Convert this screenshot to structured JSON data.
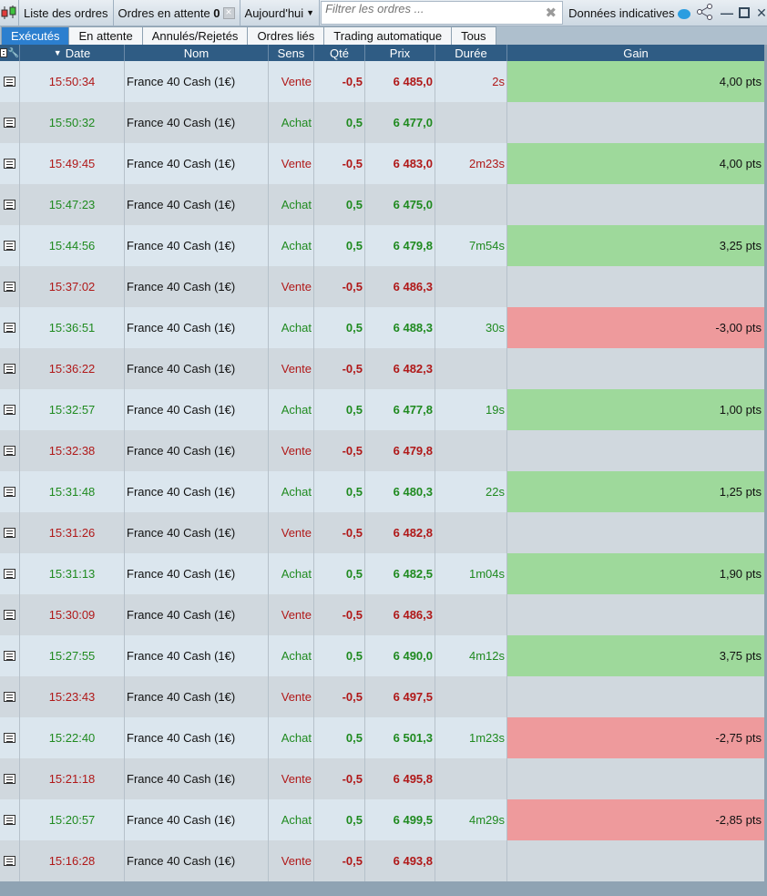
{
  "toolbar": {
    "logo_icon": "candlestick-chart-icon",
    "list_label": "Liste des ordres",
    "pending_label": "Ordres en attente",
    "pending_count": "0",
    "period_label": "Aujourd'hui",
    "filter_placeholder": "Filtrer les ordres ...",
    "data_label": "Données indicatives"
  },
  "tabs": [
    {
      "label": "Exécutés",
      "active": true
    },
    {
      "label": "En attente"
    },
    {
      "label": "Annulés/Rejetés"
    },
    {
      "label": "Ordres liés"
    },
    {
      "label": "Trading automatique"
    },
    {
      "label": "Tous"
    }
  ],
  "columns": {
    "date": "Date",
    "nom": "Nom",
    "sens": "Sens",
    "qte": "Qté",
    "prix": "Prix",
    "duree": "Durée",
    "gain": "Gain"
  },
  "colors": {
    "buy": "#1f8a1f",
    "sell": "#b01818",
    "gain_positive": "#9ed99b",
    "gain_negative": "#ee9a9c"
  },
  "orders": [
    {
      "date": "15:50:34",
      "nom": "France 40 Cash (1€)",
      "sens": "Vente",
      "qte": "-0,5",
      "prix": "6 485,0",
      "duree": "2s",
      "gain": "4,00 pts"
    },
    {
      "date": "15:50:32",
      "nom": "France 40 Cash (1€)",
      "sens": "Achat",
      "qte": "0,5",
      "prix": "6 477,0",
      "duree": "",
      "gain": ""
    },
    {
      "date": "15:49:45",
      "nom": "France 40 Cash (1€)",
      "sens": "Vente",
      "qte": "-0,5",
      "prix": "6 483,0",
      "duree": "2m23s",
      "gain": "4,00 pts"
    },
    {
      "date": "15:47:23",
      "nom": "France 40 Cash (1€)",
      "sens": "Achat",
      "qte": "0,5",
      "prix": "6 475,0",
      "duree": "",
      "gain": ""
    },
    {
      "date": "15:44:56",
      "nom": "France 40 Cash (1€)",
      "sens": "Achat",
      "qte": "0,5",
      "prix": "6 479,8",
      "duree": "7m54s",
      "gain": "3,25 pts"
    },
    {
      "date": "15:37:02",
      "nom": "France 40 Cash (1€)",
      "sens": "Vente",
      "qte": "-0,5",
      "prix": "6 486,3",
      "duree": "",
      "gain": ""
    },
    {
      "date": "15:36:51",
      "nom": "France 40 Cash (1€)",
      "sens": "Achat",
      "qte": "0,5",
      "prix": "6 488,3",
      "duree": "30s",
      "gain": "-3,00 pts"
    },
    {
      "date": "15:36:22",
      "nom": "France 40 Cash (1€)",
      "sens": "Vente",
      "qte": "-0,5",
      "prix": "6 482,3",
      "duree": "",
      "gain": ""
    },
    {
      "date": "15:32:57",
      "nom": "France 40 Cash (1€)",
      "sens": "Achat",
      "qte": "0,5",
      "prix": "6 477,8",
      "duree": "19s",
      "gain": "1,00 pts"
    },
    {
      "date": "15:32:38",
      "nom": "France 40 Cash (1€)",
      "sens": "Vente",
      "qte": "-0,5",
      "prix": "6 479,8",
      "duree": "",
      "gain": ""
    },
    {
      "date": "15:31:48",
      "nom": "France 40 Cash (1€)",
      "sens": "Achat",
      "qte": "0,5",
      "prix": "6 480,3",
      "duree": "22s",
      "gain": "1,25 pts"
    },
    {
      "date": "15:31:26",
      "nom": "France 40 Cash (1€)",
      "sens": "Vente",
      "qte": "-0,5",
      "prix": "6 482,8",
      "duree": "",
      "gain": ""
    },
    {
      "date": "15:31:13",
      "nom": "France 40 Cash (1€)",
      "sens": "Achat",
      "qte": "0,5",
      "prix": "6 482,5",
      "duree": "1m04s",
      "gain": "1,90 pts"
    },
    {
      "date": "15:30:09",
      "nom": "France 40 Cash (1€)",
      "sens": "Vente",
      "qte": "-0,5",
      "prix": "6 486,3",
      "duree": "",
      "gain": ""
    },
    {
      "date": "15:27:55",
      "nom": "France 40 Cash (1€)",
      "sens": "Achat",
      "qte": "0,5",
      "prix": "6 490,0",
      "duree": "4m12s",
      "gain": "3,75 pts"
    },
    {
      "date": "15:23:43",
      "nom": "France 40 Cash (1€)",
      "sens": "Vente",
      "qte": "-0,5",
      "prix": "6 497,5",
      "duree": "",
      "gain": ""
    },
    {
      "date": "15:22:40",
      "nom": "France 40 Cash (1€)",
      "sens": "Achat",
      "qte": "0,5",
      "prix": "6 501,3",
      "duree": "1m23s",
      "gain": "-2,75 pts"
    },
    {
      "date": "15:21:18",
      "nom": "France 40 Cash (1€)",
      "sens": "Vente",
      "qte": "-0,5",
      "prix": "6 495,8",
      "duree": "",
      "gain": ""
    },
    {
      "date": "15:20:57",
      "nom": "France 40 Cash (1€)",
      "sens": "Achat",
      "qte": "0,5",
      "prix": "6 499,5",
      "duree": "4m29s",
      "gain": "-2,85 pts"
    },
    {
      "date": "15:16:28",
      "nom": "France 40 Cash (1€)",
      "sens": "Vente",
      "qte": "-0,5",
      "prix": "6 493,8",
      "duree": "",
      "gain": ""
    }
  ]
}
